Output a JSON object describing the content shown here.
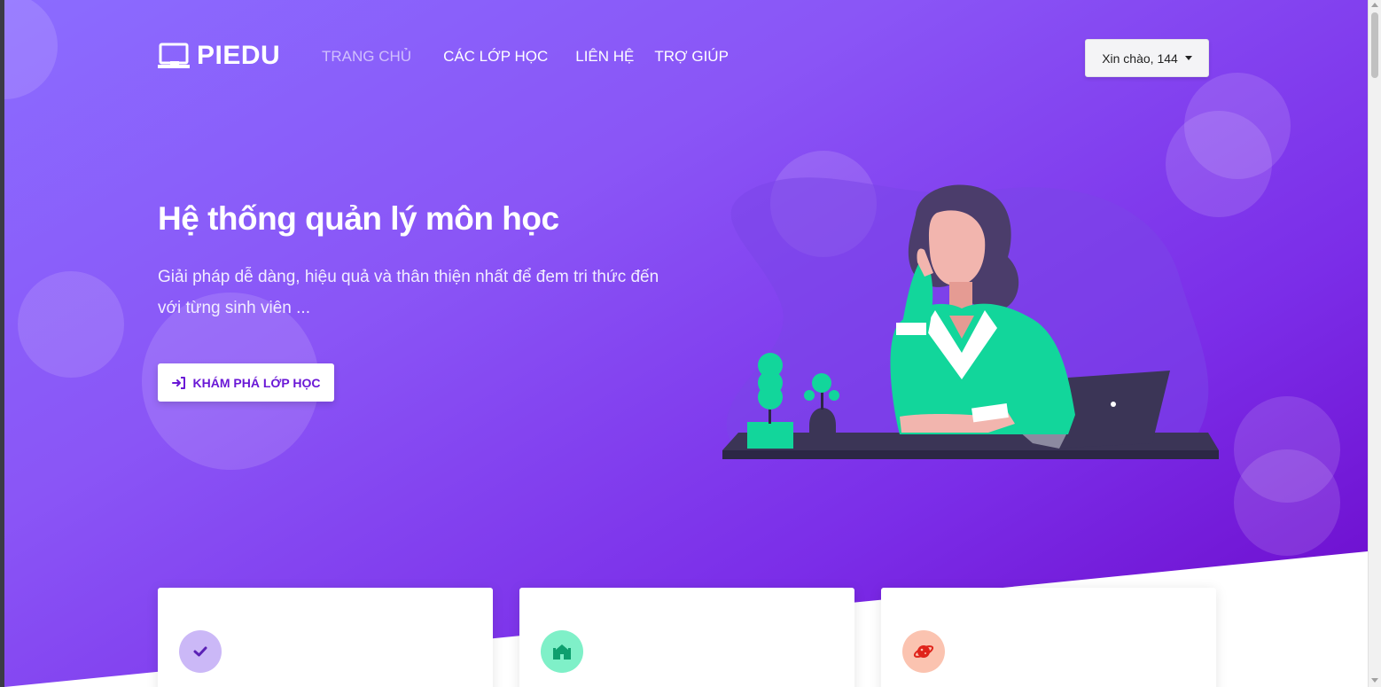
{
  "brand": {
    "name": "PIEDU",
    "icon": "laptop-icon"
  },
  "nav": {
    "items": [
      {
        "label": "TRANG CHỦ",
        "active": true
      },
      {
        "label": "CÁC LỚP HỌC",
        "active": false
      },
      {
        "label": "LIÊN HỆ",
        "active": false
      },
      {
        "label": "TRỢ GIÚP",
        "active": false
      }
    ]
  },
  "user_menu": {
    "label": "Xin chào, 144",
    "icon": "caret-down-icon"
  },
  "hero": {
    "title": "Hệ thống quản lý môn học",
    "subtitle": "Giải pháp dễ dàng, hiệu quả và thân thiện nhất để đem tri thức đến với từng sinh viên ...",
    "cta_label": "KHÁM PHÁ LỚP HỌC",
    "cta_icon": "sign-in-icon"
  },
  "cards": [
    {
      "icon": "check-icon",
      "icon_bg": "#cbb8f7",
      "icon_color": "#5b21b6"
    },
    {
      "icon": "school-icon",
      "icon_bg": "#7ff0c8",
      "icon_color": "#0e9f6e"
    },
    {
      "icon": "planet-icon",
      "icon_bg": "#fbc3b0",
      "icon_color": "#e0241b"
    }
  ],
  "colors": {
    "gradient_start": "#8b6cff",
    "gradient_end": "#6b07c8",
    "cta_text": "#6a18d6",
    "nav_active": "rgba(255,255,255,0.6)"
  }
}
